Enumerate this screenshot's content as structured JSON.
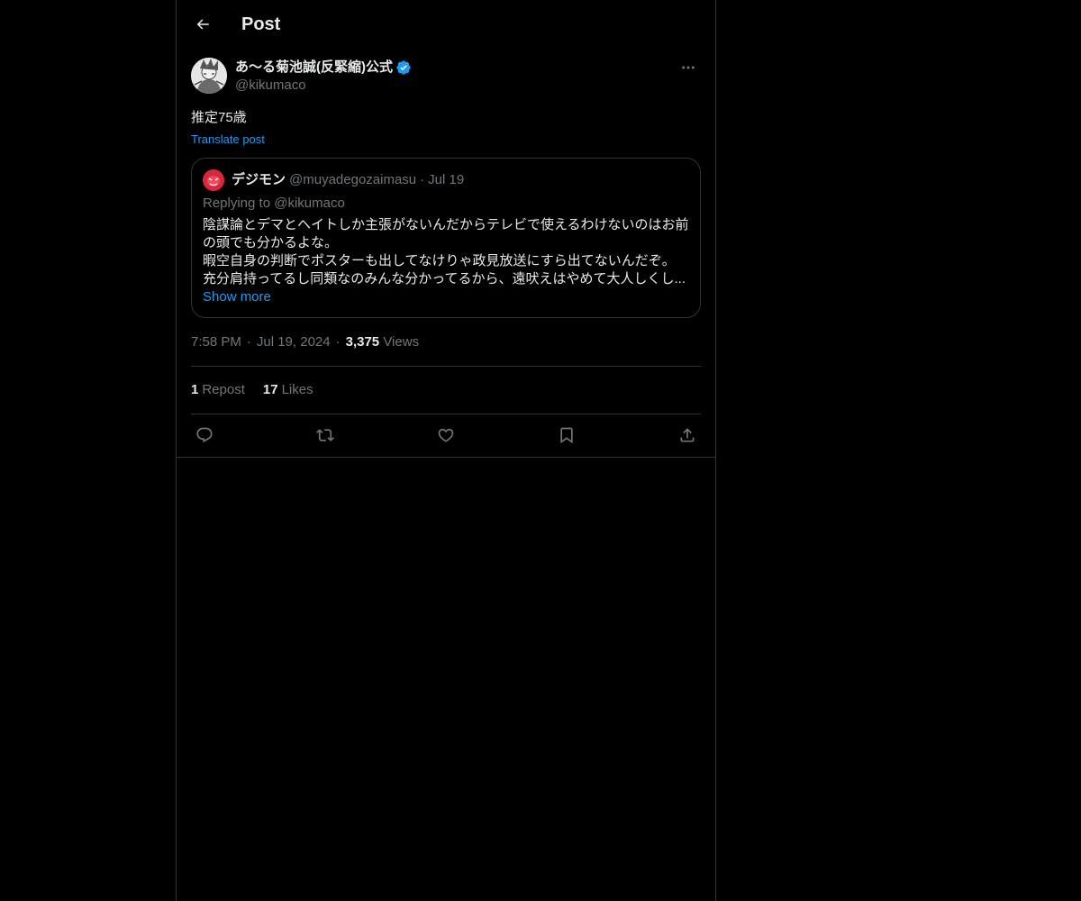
{
  "header": {
    "title": "Post",
    "back_icon": "arrow-left-icon"
  },
  "post": {
    "author": {
      "display_name": "あ〜る菊池誠(反緊縮)公式",
      "handle": "@kikumaco",
      "verified_icon": "verified-badge-icon",
      "verified_color": "#1d9bf0"
    },
    "more_icon": "more-horizontal-icon",
    "text": "推定75歳",
    "translate_label": "Translate post",
    "quote": {
      "name": "デジモン",
      "handle": "@muyadegozaimasu",
      "separator": "·",
      "date": "Jul 19",
      "replying_to": "Replying to @kikumaco",
      "body_lines": [
        "陰謀論とデマとヘイトしか主張がないんだからテレビで使えるわけないのはお前",
        "の頭でも分かるよな。",
        "暇空自身の判断でポスターも出してなけりゃ政見放送にすら出てないんだぞ。",
        "充分肩持ってるし同類なのみんな分かってるから、遠吠えはやめて大人しくし..."
      ],
      "show_more": "Show more"
    },
    "meta": {
      "time": "7:58 PM",
      "separator": "·",
      "date": "Jul 19, 2024",
      "views_count": "3,375",
      "views_label": "Views"
    },
    "stats": {
      "reposts_count": "1",
      "reposts_label": "Repost",
      "likes_count": "17",
      "likes_label": "Likes"
    },
    "actions": [
      {
        "name": "reply-icon"
      },
      {
        "name": "repost-icon"
      },
      {
        "name": "like-icon"
      },
      {
        "name": "bookmark-icon"
      },
      {
        "name": "share-icon"
      }
    ]
  },
  "colors": {
    "background": "#000000",
    "text": "#e7e9ea",
    "muted": "#71767b",
    "accent": "#1d9bf0",
    "border": "#2f3336"
  }
}
